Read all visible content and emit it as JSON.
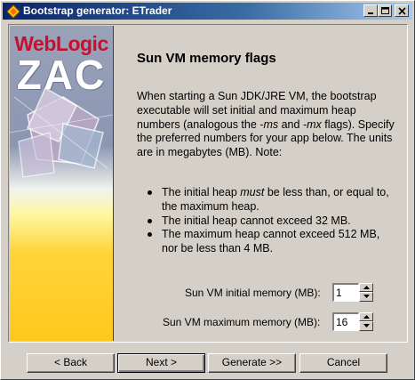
{
  "window": {
    "title": "Bootstrap generator: ETrader"
  },
  "sidebar": {
    "brand_top": "WebLogic",
    "brand_main": "ZAC"
  },
  "content": {
    "heading": "Sun VM memory flags",
    "intro_part1": "When starting a Sun JDK/JRE VM, the bootstrap executable will set initial and maximum heap numbers (analogous the ",
    "flag_ms": "-ms",
    "intro_and": " and ",
    "flag_mx": "-mx",
    "intro_part2": " flags). Specify the preferred numbers for your app below. The units are in megabytes (MB). Note:",
    "note1_pre": "The initial heap ",
    "note1_em": "must",
    "note1_post": " be less than, or equal to, the maximum heap.",
    "note2": "The initial heap cannot exceed 32 MB.",
    "note3": "The maximum heap cannot exceed 512 MB, nor be less than 4 MB."
  },
  "fields": {
    "initial_label": "Sun VM initial memory (MB):",
    "initial_value": "1",
    "maximum_label": "Sun VM maximum memory (MB):",
    "maximum_value": "16"
  },
  "buttons": {
    "back": "< Back",
    "next": "Next >",
    "generate": "Generate >>",
    "cancel": "Cancel"
  },
  "colors": {
    "title_bar": "#0a246a",
    "brand_red": "#c8102e",
    "face": "#d4d0c8"
  }
}
